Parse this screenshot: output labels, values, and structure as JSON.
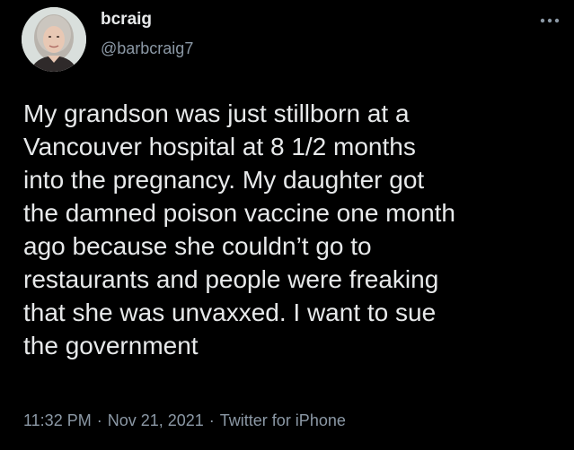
{
  "author": {
    "display_name": "bcraig",
    "handle": "@barbcraig7",
    "avatar_icon": "profile-photo"
  },
  "more_icon": "more-horizontal-icon",
  "tweet": {
    "lines": [
      "My grandson was just stillborn at a",
      "Vancouver hospital at 8 1/2 months",
      "into the pregnancy. My daughter got",
      "the damned poison vaccine one month",
      "ago because she couldn’t go to",
      "restaurants and people were freaking",
      "that she was unvaxxed. I want to sue",
      "the government"
    ]
  },
  "meta": {
    "time": "11:32 PM",
    "separator": "·",
    "date": "Nov 21, 2021",
    "source": "Twitter for iPhone"
  },
  "colors": {
    "background": "#000000",
    "primary_text": "#e7e9ea",
    "secondary_text": "#8b98a5"
  }
}
